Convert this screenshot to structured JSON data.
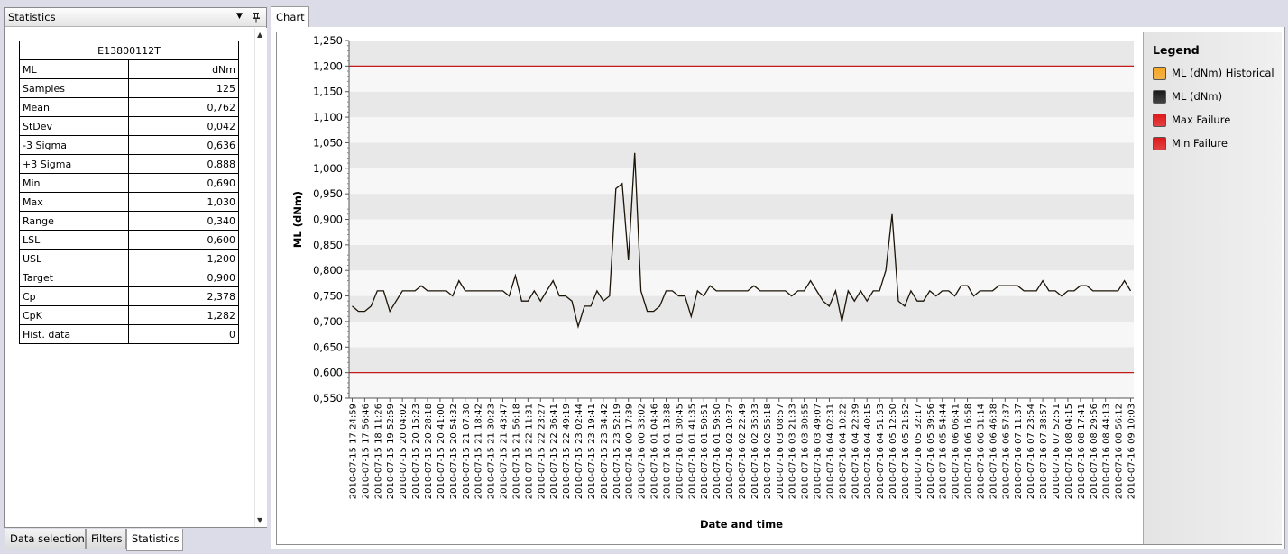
{
  "left_panel": {
    "title": "Statistics",
    "table": {
      "header": "E13800112T",
      "rows": [
        {
          "label": "ML",
          "value": "dNm"
        },
        {
          "label": "Samples",
          "value": "125"
        },
        {
          "label": "Mean",
          "value": "0,762"
        },
        {
          "label": "StDev",
          "value": "0,042"
        },
        {
          "label": "-3 Sigma",
          "value": "0,636"
        },
        {
          "label": "+3 Sigma",
          "value": "0,888"
        },
        {
          "label": "Min",
          "value": "0,690"
        },
        {
          "label": "Max",
          "value": "1,030"
        },
        {
          "label": "Range",
          "value": "0,340"
        },
        {
          "label": "LSL",
          "value": "0,600"
        },
        {
          "label": "USL",
          "value": "1,200"
        },
        {
          "label": "Target",
          "value": "0,900"
        },
        {
          "label": "Cp",
          "value": "2,378"
        },
        {
          "label": "CpK",
          "value": "1,282"
        },
        {
          "label": "Hist. data",
          "value": "0"
        }
      ]
    }
  },
  "bottom_tabs": [
    "Data selection",
    "Filters",
    "Statistics"
  ],
  "active_bottom_tab": "Statistics",
  "chart_tab": "Chart",
  "legend": {
    "title": "Legend",
    "items": [
      {
        "label": "ML (dNm) Historical",
        "color": "#f6a623"
      },
      {
        "label": "ML (dNm)",
        "color": "#1a1a1a"
      },
      {
        "label": "Max Failure",
        "color": "#e0191b"
      },
      {
        "label": "Min Failure",
        "color": "#e0191b"
      }
    ]
  },
  "colors": {
    "series_line": "#1c1407",
    "limit_line": "#c41a1a",
    "band_gray": "#e8e8e8",
    "band_light": "#f7f7f7"
  },
  "chart_data": {
    "type": "line",
    "xlabel": "Date and time",
    "ylabel": "ML (dNm)",
    "ylim": [
      0.55,
      1.25
    ],
    "y_ticks": [
      "0,550",
      "0,600",
      "0,650",
      "0,700",
      "0,750",
      "0,800",
      "0,850",
      "0,900",
      "0,950",
      "1,000",
      "1,050",
      "1,100",
      "1,150",
      "1,200",
      "1,250"
    ],
    "x_tick_labels": [
      "2010-07-15 17:24:59",
      "2010-07-15 17:56:46",
      "2010-07-15 18:11:26",
      "2010-07-15 19:52:59",
      "2010-07-15 20:04:02",
      "2010-07-15 20:15:23",
      "2010-07-15 20:28:18",
      "2010-07-15 20:41:00",
      "2010-07-15 20:54:32",
      "2010-07-15 21:07:30",
      "2010-07-15 21:18:42",
      "2010-07-15 21:30:23",
      "2010-07-15 21:43:47",
      "2010-07-15 21:56:18",
      "2010-07-15 22:11:31",
      "2010-07-15 22:23:27",
      "2010-07-15 22:36:41",
      "2010-07-15 22:49:19",
      "2010-07-15 23:02:44",
      "2010-07-15 23:19:41",
      "2010-07-15 23:34:42",
      "2010-07-15 23:52:19",
      "2010-07-16 00:17:39",
      "2010-07-16 00:33:02",
      "2010-07-16 01:04:46",
      "2010-07-16 01:13:38",
      "2010-07-16 01:30:45",
      "2010-07-16 01:41:35",
      "2010-07-16 01:50:51",
      "2010-07-16 01:59:50",
      "2010-07-16 02:10:37",
      "2010-07-16 02:22:49",
      "2010-07-16 02:35:33",
      "2010-07-16 02:55:18",
      "2010-07-16 03:08:57",
      "2010-07-16 03:21:33",
      "2010-07-16 03:30:55",
      "2010-07-16 03:49:07",
      "2010-07-16 04:02:31",
      "2010-07-16 04:10:22",
      "2010-07-16 04:22:39",
      "2010-07-16 04:40:15",
      "2010-07-16 04:51:53",
      "2010-07-16 05:12:50",
      "2010-07-16 05:21:52",
      "2010-07-16 05:32:17",
      "2010-07-16 05:39:56",
      "2010-07-16 05:54:44",
      "2010-07-16 06:06:41",
      "2010-07-16 06:16:58",
      "2010-07-16 06:31:14",
      "2010-07-16 06:46:38",
      "2010-07-16 06:57:37",
      "2010-07-16 07:11:37",
      "2010-07-16 07:23:54",
      "2010-07-16 07:38:57",
      "2010-07-16 07:52:51",
      "2010-07-16 08:04:15",
      "2010-07-16 08:17:41",
      "2010-07-16 08:29:56",
      "2010-07-16 08:44:13",
      "2010-07-16 08:56:12",
      "2010-07-16 09:10:03"
    ],
    "series": [
      {
        "name": "ML (dNm)",
        "values": [
          0.73,
          0.72,
          0.72,
          0.73,
          0.76,
          0.76,
          0.72,
          0.74,
          0.76,
          0.76,
          0.76,
          0.77,
          0.76,
          0.76,
          0.76,
          0.76,
          0.75,
          0.78,
          0.76,
          0.76,
          0.76,
          0.76,
          0.76,
          0.76,
          0.76,
          0.75,
          0.79,
          0.74,
          0.74,
          0.76,
          0.74,
          0.76,
          0.78,
          0.75,
          0.75,
          0.74,
          0.69,
          0.73,
          0.73,
          0.76,
          0.74,
          0.75,
          0.96,
          0.97,
          0.82,
          1.03,
          0.76,
          0.72,
          0.72,
          0.73,
          0.76,
          0.76,
          0.75,
          0.75,
          0.71,
          0.76,
          0.75,
          0.77,
          0.76,
          0.76,
          0.76,
          0.76,
          0.76,
          0.76,
          0.77,
          0.76,
          0.76,
          0.76,
          0.76,
          0.76,
          0.75,
          0.76,
          0.76,
          0.78,
          0.76,
          0.74,
          0.73,
          0.76,
          0.7,
          0.76,
          0.74,
          0.76,
          0.74,
          0.76,
          0.76,
          0.8,
          0.91,
          0.74,
          0.73,
          0.76,
          0.74,
          0.74,
          0.76,
          0.75,
          0.76,
          0.76,
          0.75,
          0.77,
          0.77,
          0.75,
          0.76,
          0.76,
          0.76,
          0.77,
          0.77,
          0.77,
          0.77,
          0.76,
          0.76,
          0.76,
          0.78,
          0.76,
          0.76,
          0.75,
          0.76,
          0.76,
          0.77,
          0.77,
          0.76,
          0.76,
          0.76,
          0.76,
          0.76,
          0.78,
          0.76
        ]
      }
    ],
    "limits": [
      {
        "name": "Max Failure",
        "value": 1.2
      },
      {
        "name": "Min Failure",
        "value": 0.6
      }
    ]
  }
}
